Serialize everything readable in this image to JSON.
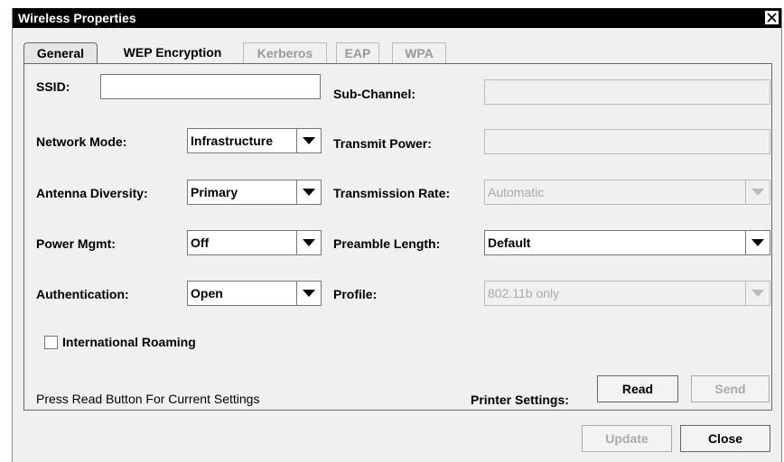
{
  "window": {
    "title": "Wireless Properties"
  },
  "tabs": [
    {
      "label": "General",
      "state": "active"
    },
    {
      "label": "WEP Encryption",
      "state": "enabled"
    },
    {
      "label": "Kerberos",
      "state": "disabled"
    },
    {
      "label": "EAP",
      "state": "disabled"
    },
    {
      "label": "WPA",
      "state": "disabled"
    }
  ],
  "left": {
    "ssid_label": "SSID:",
    "ssid_value": "",
    "network_mode_label": "Network Mode:",
    "network_mode_value": "Infrastructure",
    "antenna_label": "Antenna Diversity:",
    "antenna_value": "Primary",
    "power_label": "Power Mgmt:",
    "power_value": "Off",
    "auth_label": "Authentication:",
    "auth_value": "Open",
    "intl_roaming_label": "International Roaming",
    "intl_roaming_checked": false
  },
  "right": {
    "subchannel_label": "Sub-Channel:",
    "subchannel_value": "",
    "transmit_power_label": "Transmit Power:",
    "transmit_power_value": "",
    "tx_rate_label": "Transmission Rate:",
    "tx_rate_value": "Automatic",
    "preamble_label": "Preamble Length:",
    "preamble_value": "Default",
    "profile_label": "Profile:",
    "profile_value": "802.11b only"
  },
  "footer": {
    "status_text": "Press Read Button For Current Settings",
    "printer_settings_label": "Printer Settings:",
    "read_label": "Read",
    "send_label": "Send",
    "update_label": "Update",
    "close_label": "Close"
  }
}
